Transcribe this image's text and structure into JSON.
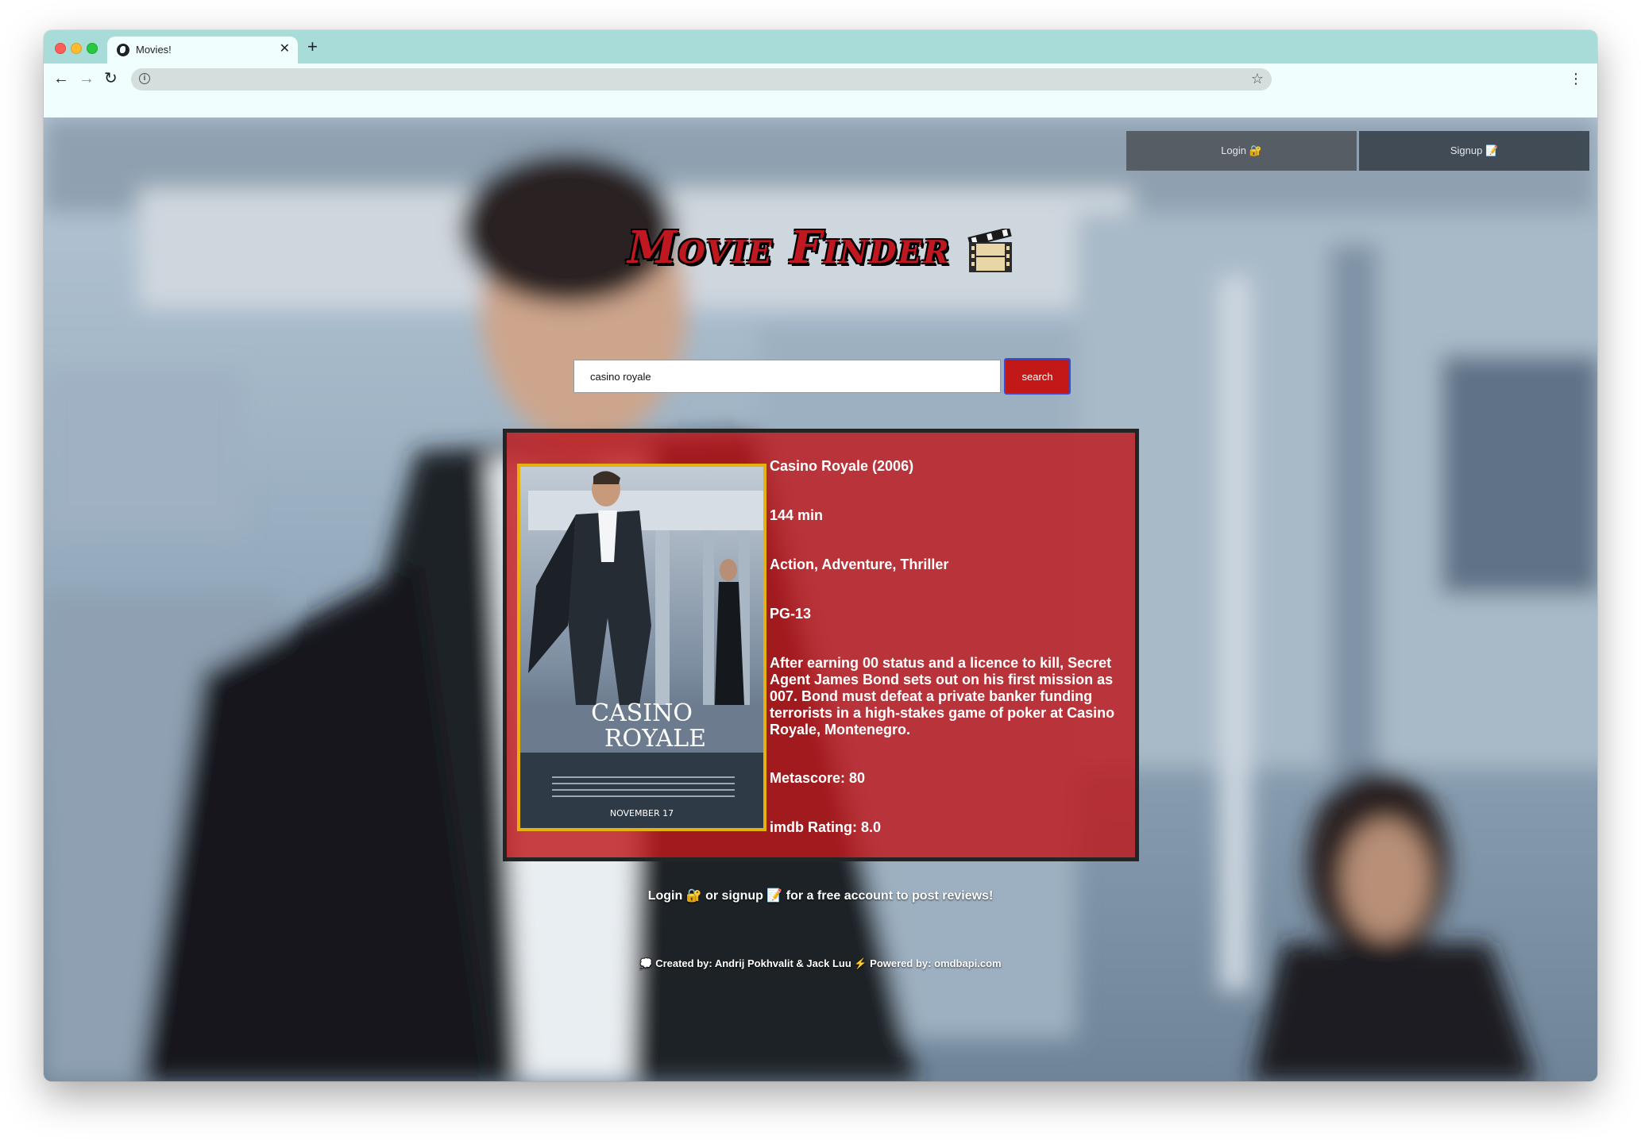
{
  "browser": {
    "tab_title": "Movies!",
    "tab_close": "✕",
    "new_tab": "+",
    "back": "←",
    "forward": "→",
    "reload": "↻",
    "info": "i",
    "star": "☆",
    "menu": "⋮",
    "url": ""
  },
  "header": {
    "login_label": "Login 🔐",
    "signup_label": "Signup 📝"
  },
  "app": {
    "title": "Movie Finder",
    "title_icon": "film-frames-icon"
  },
  "search": {
    "value": "casino royale",
    "button_label": "search"
  },
  "movie": {
    "title": "Casino Royale (2006)",
    "runtime": "144 min",
    "genre": "Action, Adventure, Thriller",
    "rated": "PG-13",
    "plot": "After earning 00 status and a licence to kill, Secret Agent James Bond sets out on his first mission as 007. Bond must defeat a private banker funding terrorists in a high-stakes game of poker at Casino Royale, Montenegro.",
    "metascore": "Metascore: 80",
    "imdb_rating": "imdb Rating: 8.0",
    "poster": {
      "title_line1": "CASINO",
      "title_line2": "ROYALE",
      "release": "NOVEMBER 17"
    }
  },
  "footer": {
    "cta_login": "Login 🔐",
    "cta_or": " or ",
    "cta_signup": "signup 📝",
    "cta_rest": " for a free account to post reviews!",
    "credits": "💭 Created by: Andrij Pokhvalit & Jack Luu ⚡️ Powered by: omdbapi.com"
  },
  "colors": {
    "tabstrip": "#a8dcd8",
    "toolbar": "#f0fffe",
    "card_red": "#be181c",
    "poster_border": "#e8b00d",
    "search_button": "#c21818"
  }
}
